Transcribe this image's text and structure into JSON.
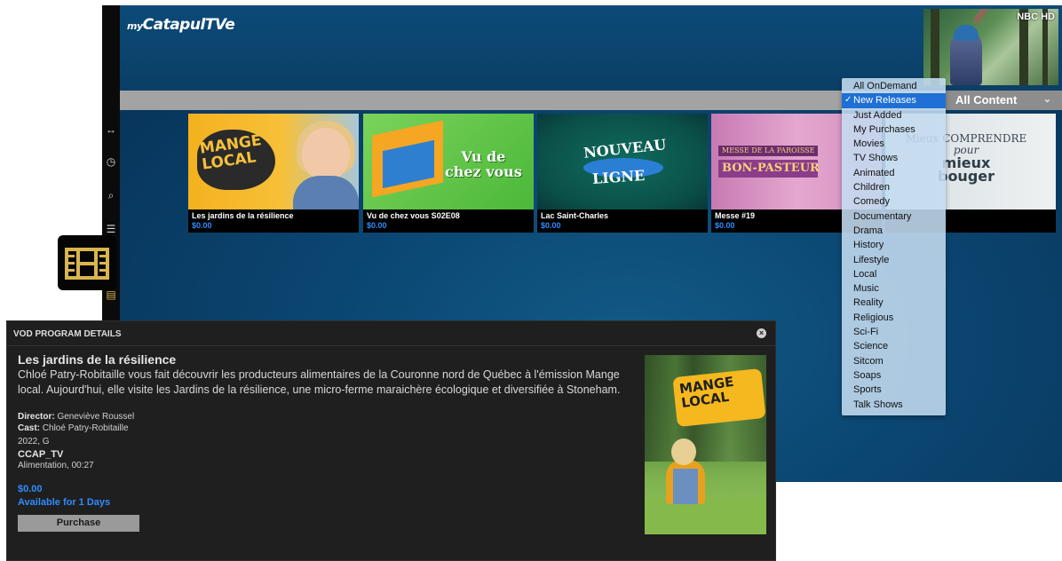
{
  "app": {
    "logo": {
      "prefix": "my",
      "name": "CatapulTVe"
    },
    "pip_label": "NBC HD",
    "content_select": {
      "value": "All Content"
    }
  },
  "sidebar_icons": [
    "resize-icon",
    "clock-icon",
    "search-icon",
    "list-icon",
    "film-icon"
  ],
  "tiles": [
    {
      "title": "Les jardins de la résilience",
      "price": "$0.00",
      "art": [
        "MANGE",
        "LOCAL"
      ]
    },
    {
      "title": "Vu de chez vous S02E08",
      "price": "$0.00",
      "art": [
        "Vu de",
        "chez vous"
      ]
    },
    {
      "title": "Lac Saint-Charles",
      "price": "$0.00",
      "art": [
        "NOUVEAU",
        "LIGNE"
      ]
    },
    {
      "title": "Messe #19",
      "price": "$0.00",
      "art": [
        "MESSE DE LA PAROISSE",
        "BON-PASTEUR"
      ]
    },
    {
      "title": "",
      "price": "",
      "art": [
        "Mieux COMPRENDRE",
        "pour",
        "mieux",
        "bouger"
      ]
    }
  ],
  "dropdown": {
    "selected": "New Releases",
    "items": [
      "All OnDemand",
      "New Releases",
      "Just Added",
      "My Purchases",
      "Movies",
      "TV Shows",
      "Animated",
      "Children",
      "Comedy",
      "Documentary",
      "Drama",
      "History",
      "Lifestyle",
      "Local",
      "Music",
      "Reality",
      "Religious",
      "Sci-Fi",
      "Science",
      "Sitcom",
      "Soaps",
      "Sports",
      "Talk Shows"
    ]
  },
  "vod": {
    "header": "VOD PROGRAM DETAILS",
    "title": "Les jardins de la résilience",
    "description": "Chloé Patry-Robitaille vous fait découvrir les producteurs alimentaires de la Couronne nord de Québec à l'émission Mange local. Aujourd'hui, elle visite les Jardins de la résilience, une micro-ferme maraichère écologique et diversifiée à Stoneham.",
    "director_label": "Director:",
    "director": "Geneviève Roussel",
    "cast_label": "Cast:",
    "cast": "Chloé Patry-Robitaille",
    "year_rating": "2022, G",
    "channel": "CCAP_TV",
    "genre_duration": "Alimentation, 00:27",
    "price": "$0.00",
    "availability": "Available for 1 Days",
    "purchase_label": "Purchase",
    "poster_text": [
      "MANGE",
      "LOCAL"
    ]
  }
}
